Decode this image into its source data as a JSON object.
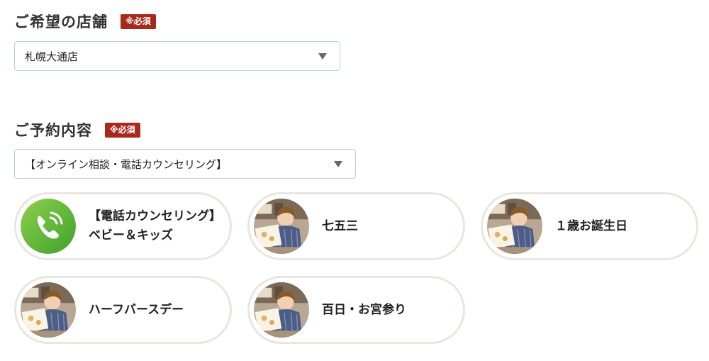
{
  "store_section": {
    "title": "ご希望の店舗",
    "required_badge": "※必須",
    "select_value": "札幌大通店"
  },
  "reservation_section": {
    "title": "ご予約内容",
    "required_badge": "※必須",
    "select_value": "【オンライン相談・電話カウンセリング】"
  },
  "menu_cards": [
    {
      "line1": "【電話カウンセリング】",
      "line2": "ベビー＆キッズ",
      "icon": "phone-icon"
    },
    {
      "line1": "七五三",
      "icon": "photo-thumbnail"
    },
    {
      "line1": "１歳お誕生日",
      "icon": "photo-thumbnail"
    },
    {
      "line1": "ハーフバースデー",
      "icon": "photo-thumbnail"
    },
    {
      "line1": "百日・お宮参り",
      "icon": "photo-thumbnail"
    }
  ],
  "colors": {
    "badge": "#a8291c",
    "card_border": "#e9e6e0",
    "select_border": "#bcd2d2",
    "phone_green": "#5ab43a"
  }
}
